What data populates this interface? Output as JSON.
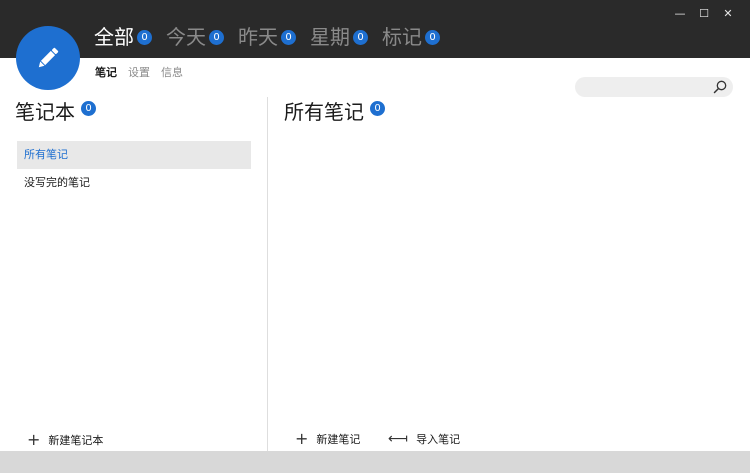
{
  "window": {
    "minimize": "—",
    "maximize": "☐",
    "close": "✕"
  },
  "filters": [
    {
      "label": "全部",
      "count": "0",
      "active": true
    },
    {
      "label": "今天",
      "count": "0",
      "active": false
    },
    {
      "label": "昨天",
      "count": "0",
      "active": false
    },
    {
      "label": "星期",
      "count": "0",
      "active": false
    },
    {
      "label": "标记",
      "count": "0",
      "active": false
    }
  ],
  "subnav": [
    {
      "label": "笔记",
      "active": true
    },
    {
      "label": "设置",
      "active": false
    },
    {
      "label": "信息",
      "active": false
    }
  ],
  "search": {
    "placeholder": ""
  },
  "notebooks": {
    "title": "笔记本",
    "count": "0",
    "items": [
      {
        "label": "所有笔记",
        "selected": true
      },
      {
        "label": "没写完的笔记",
        "selected": false
      }
    ],
    "new_label": "新建笔记本"
  },
  "notes": {
    "title": "所有笔记",
    "count": "0",
    "new_label": "新建笔记",
    "import_label": "导入笔记"
  },
  "colors": {
    "accent": "#1e6fd0",
    "header": "#2a2a2a",
    "selected_bg": "#e8e8e8"
  },
  "icons": {
    "avatar": "pencil-icon",
    "search": "search-icon",
    "add": "plus-icon",
    "import": "import-arrow-icon"
  }
}
